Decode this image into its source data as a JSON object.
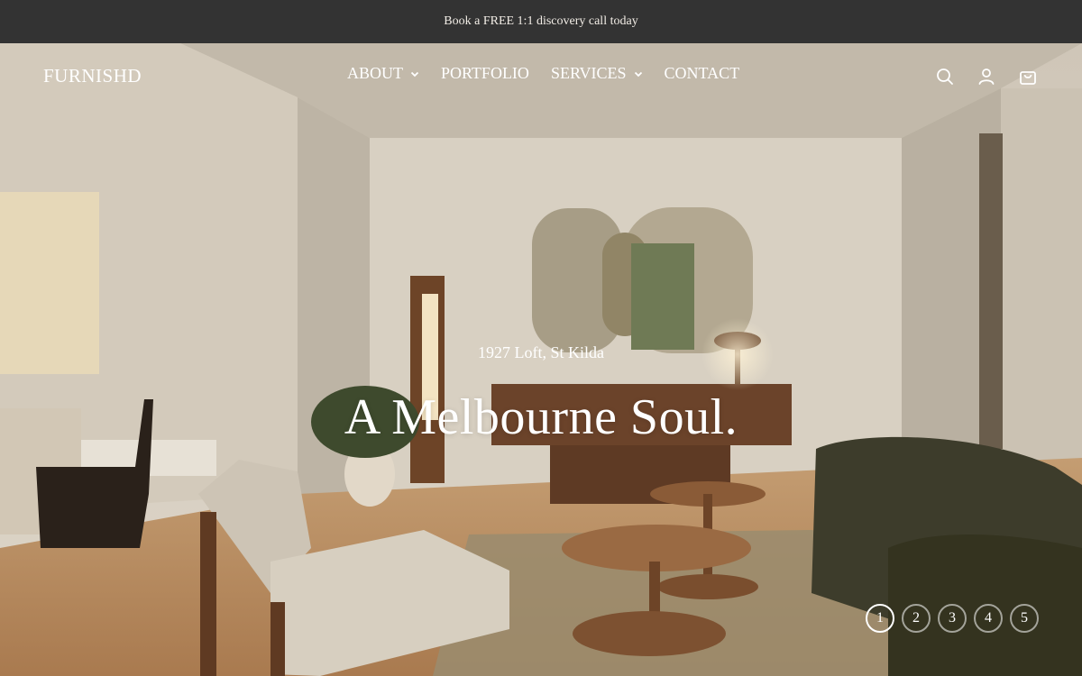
{
  "announcement": {
    "text": "Book a FREE 1:1 discovery call today"
  },
  "header": {
    "logo": "FURNISHD",
    "nav": [
      {
        "label": "ABOUT",
        "has_dropdown": true
      },
      {
        "label": "PORTFOLIO",
        "has_dropdown": false
      },
      {
        "label": "SERVICES",
        "has_dropdown": true
      },
      {
        "label": "CONTACT",
        "has_dropdown": false
      }
    ],
    "icons": [
      "search-icon",
      "account-icon",
      "cart-icon"
    ]
  },
  "hero": {
    "subtitle": "1927 Loft, St Kilda",
    "headline": "A Melbourne Soul.",
    "slides": [
      "1",
      "2",
      "3",
      "4",
      "5"
    ],
    "active_slide": "1"
  },
  "colors": {
    "announcement_bg": "#333333",
    "wall": "#d9d1c4",
    "floor": "#b98e62",
    "sofa": "#3f3f2c",
    "text": "#ffffff"
  }
}
